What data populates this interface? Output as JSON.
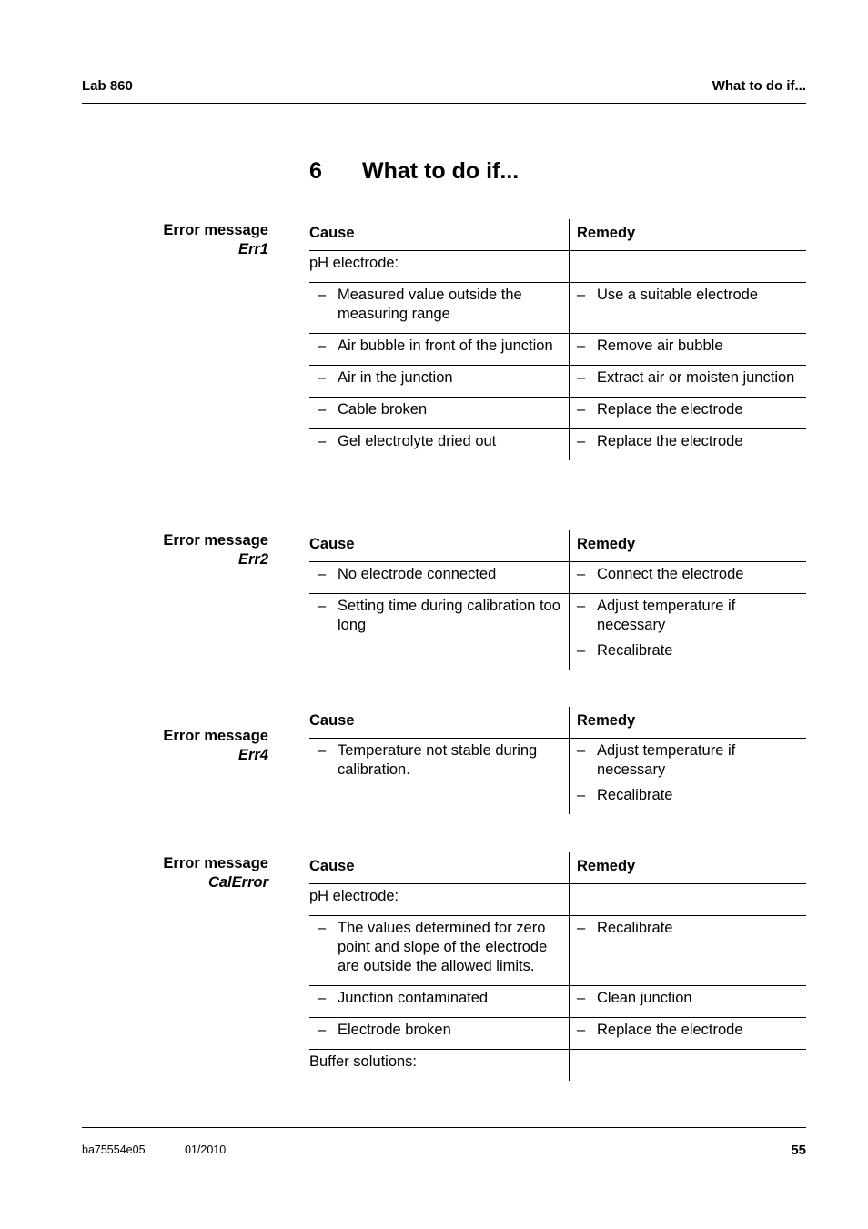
{
  "header": {
    "left": "Lab 860",
    "right": "What to do if..."
  },
  "chapter": {
    "number": "6",
    "title": "What to do if..."
  },
  "columns": {
    "cause": "Cause",
    "remedy": "Remedy"
  },
  "sections": [
    {
      "label": "Error message",
      "code": "Err1",
      "rows": [
        {
          "cause_heading": "pH electrode:",
          "causes": [],
          "remedies": []
        },
        {
          "causes": [
            "Measured value outside the measuring range"
          ],
          "remedies": [
            "Use a suitable electrode"
          ]
        },
        {
          "causes": [
            "Air bubble in front of the junction"
          ],
          "remedies": [
            "Remove air bubble"
          ]
        },
        {
          "causes": [
            "Air in the junction"
          ],
          "remedies": [
            "Extract air or moisten junction"
          ]
        },
        {
          "causes": [
            "Cable broken"
          ],
          "remedies": [
            "Replace the electrode"
          ]
        },
        {
          "causes": [
            "Gel electrolyte dried out"
          ],
          "remedies": [
            "Replace the electrode"
          ]
        }
      ]
    },
    {
      "label": "Error message",
      "code": "Err2",
      "rows": [
        {
          "causes": [
            "No electrode connected"
          ],
          "remedies": [
            "Connect the electrode"
          ]
        },
        {
          "causes": [
            "Setting time during calibration too long"
          ],
          "remedies": [
            "Adjust temperature if necessary",
            "Recalibrate"
          ]
        }
      ]
    },
    {
      "label": "Error message",
      "code": "Err4",
      "rows": [
        {
          "causes": [
            "Temperature not stable during calibration."
          ],
          "remedies": [
            "Adjust temperature if necessary",
            "Recalibrate"
          ]
        }
      ]
    },
    {
      "label": "Error message",
      "code": "CalError",
      "rows": [
        {
          "cause_heading": "pH electrode:",
          "causes": [],
          "remedies": []
        },
        {
          "causes": [
            "The values determined for zero point and slope of the electrode are outside the allowed limits."
          ],
          "remedies": [
            "Recalibrate"
          ]
        },
        {
          "causes": [
            "Junction contaminated"
          ],
          "remedies": [
            "Clean junction"
          ]
        },
        {
          "causes": [
            "Electrode broken"
          ],
          "remedies": [
            "Replace the electrode"
          ]
        },
        {
          "cause_heading": "Buffer solutions:",
          "causes": [],
          "remedies": []
        }
      ]
    }
  ],
  "footer": {
    "doc_id": "ba75554e05",
    "date": "01/2010",
    "page": "55"
  },
  "dash_glyph": "–"
}
